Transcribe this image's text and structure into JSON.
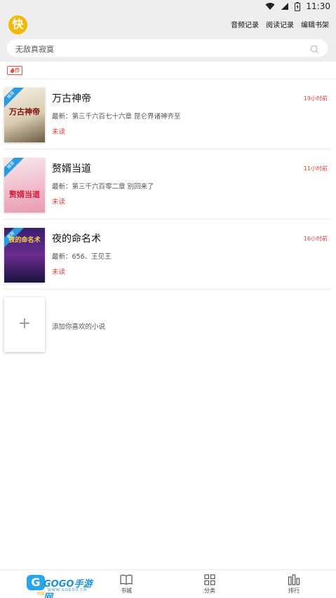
{
  "status_bar": {
    "time": "11:30",
    "icons": [
      "wifi-icon",
      "signal-icon",
      "battery-icon"
    ]
  },
  "header": {
    "logo_text": "快",
    "actions": [
      "音频记录",
      "阅读记录",
      "编辑书架"
    ]
  },
  "search": {
    "placeholder": "无敌真寂寞"
  },
  "recommend_badge": "荐",
  "books": [
    {
      "title": "万古神帝",
      "time": "19小时前",
      "latest": "最新：第三千六百七十六章 昆仑界诸神齐至",
      "status": "未读",
      "cover_tag": "推荐",
      "cover_title": "万古神帝"
    },
    {
      "title": "赘婿当道",
      "time": "11小时前",
      "latest": "最新：第三千六百零二章 别回来了",
      "status": "未读",
      "cover_tag": "推荐",
      "cover_title": "赘婿当道"
    },
    {
      "title": "夜的命名术",
      "time": "16小时前",
      "latest": "最新：656、王见王",
      "status": "未读",
      "cover_tag": "推荐",
      "cover_title": "夜的命名术"
    }
  ],
  "add_book": {
    "symbol": "+",
    "label": "添加你喜欢的小说"
  },
  "tabbar": {
    "tabs": [
      {
        "label": "书架",
        "icon": "bookshelf-icon"
      },
      {
        "label": "书城",
        "icon": "book-icon"
      },
      {
        "label": "分类",
        "icon": "grid-icon"
      },
      {
        "label": "排行",
        "icon": "ranking-icon"
      }
    ]
  },
  "watermark": {
    "main": "GOGO手游网",
    "sub": "WWW.GOGOO.CN",
    "home": "书架"
  },
  "colors": {
    "accent_red": "#e04040",
    "logo_yellow": "#f5b800",
    "tag_blue": "#2b9be0"
  }
}
